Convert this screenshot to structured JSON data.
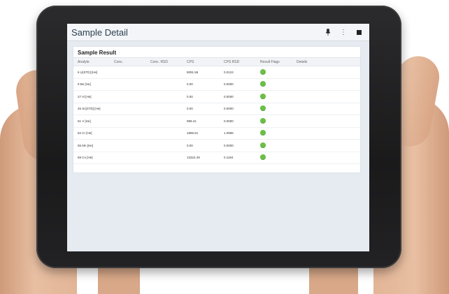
{
  "app": {
    "title": "Sample Detail",
    "icons": [
      "microphone-icon",
      "more-icon",
      "stop-icon"
    ]
  },
  "sample_result": {
    "title": "Sample Result",
    "columns": [
      "Analyte",
      "Conc.",
      "Conc. RSD",
      "CPS",
      "CPS RSD",
      "Result Flags",
      "Details"
    ],
    "rows": [
      {
        "analyte": "6 Li[STD] [He]",
        "conc": "",
        "conc_rsd": "",
        "cps": "8091.56",
        "cps_rsd": "0.0124",
        "flag_color": "#6cbf45"
      },
      {
        "analyte": "9 Be [He]",
        "conc": "",
        "conc_rsd": "",
        "cps": "0.00",
        "cps_rsd": "0.0000",
        "flag_color": "#6cbf45"
      },
      {
        "analyte": "27 Al [He]",
        "conc": "",
        "conc_rsd": "",
        "cps": "0.00",
        "cps_rsd": "0.0000",
        "flag_color": "#6cbf45"
      },
      {
        "analyte": "45 Sc[STD] [He]",
        "conc": "",
        "conc_rsd": "",
        "cps": "0.00",
        "cps_rsd": "0.0000",
        "flag_color": "#6cbf45"
      },
      {
        "analyte": "51 V [He]",
        "conc": "",
        "conc_rsd": "",
        "cps": "999.41",
        "cps_rsd": "0.0000",
        "flag_color": "#6cbf45"
      },
      {
        "analyte": "52 Cr [He]",
        "conc": "",
        "conc_rsd": "",
        "cps": "1886.61",
        "cps_rsd": "1.0996",
        "flag_color": "#6cbf45"
      },
      {
        "analyte": "55 Mn [He]",
        "conc": "",
        "conc_rsd": "",
        "cps": "0.00",
        "cps_rsd": "0.0000",
        "flag_color": "#6cbf45"
      },
      {
        "analyte": "59 Co [He]",
        "conc": "",
        "conc_rsd": "",
        "cps": "13324.49",
        "cps_rsd": "0.1194",
        "flag_color": "#6cbf45"
      }
    ]
  }
}
